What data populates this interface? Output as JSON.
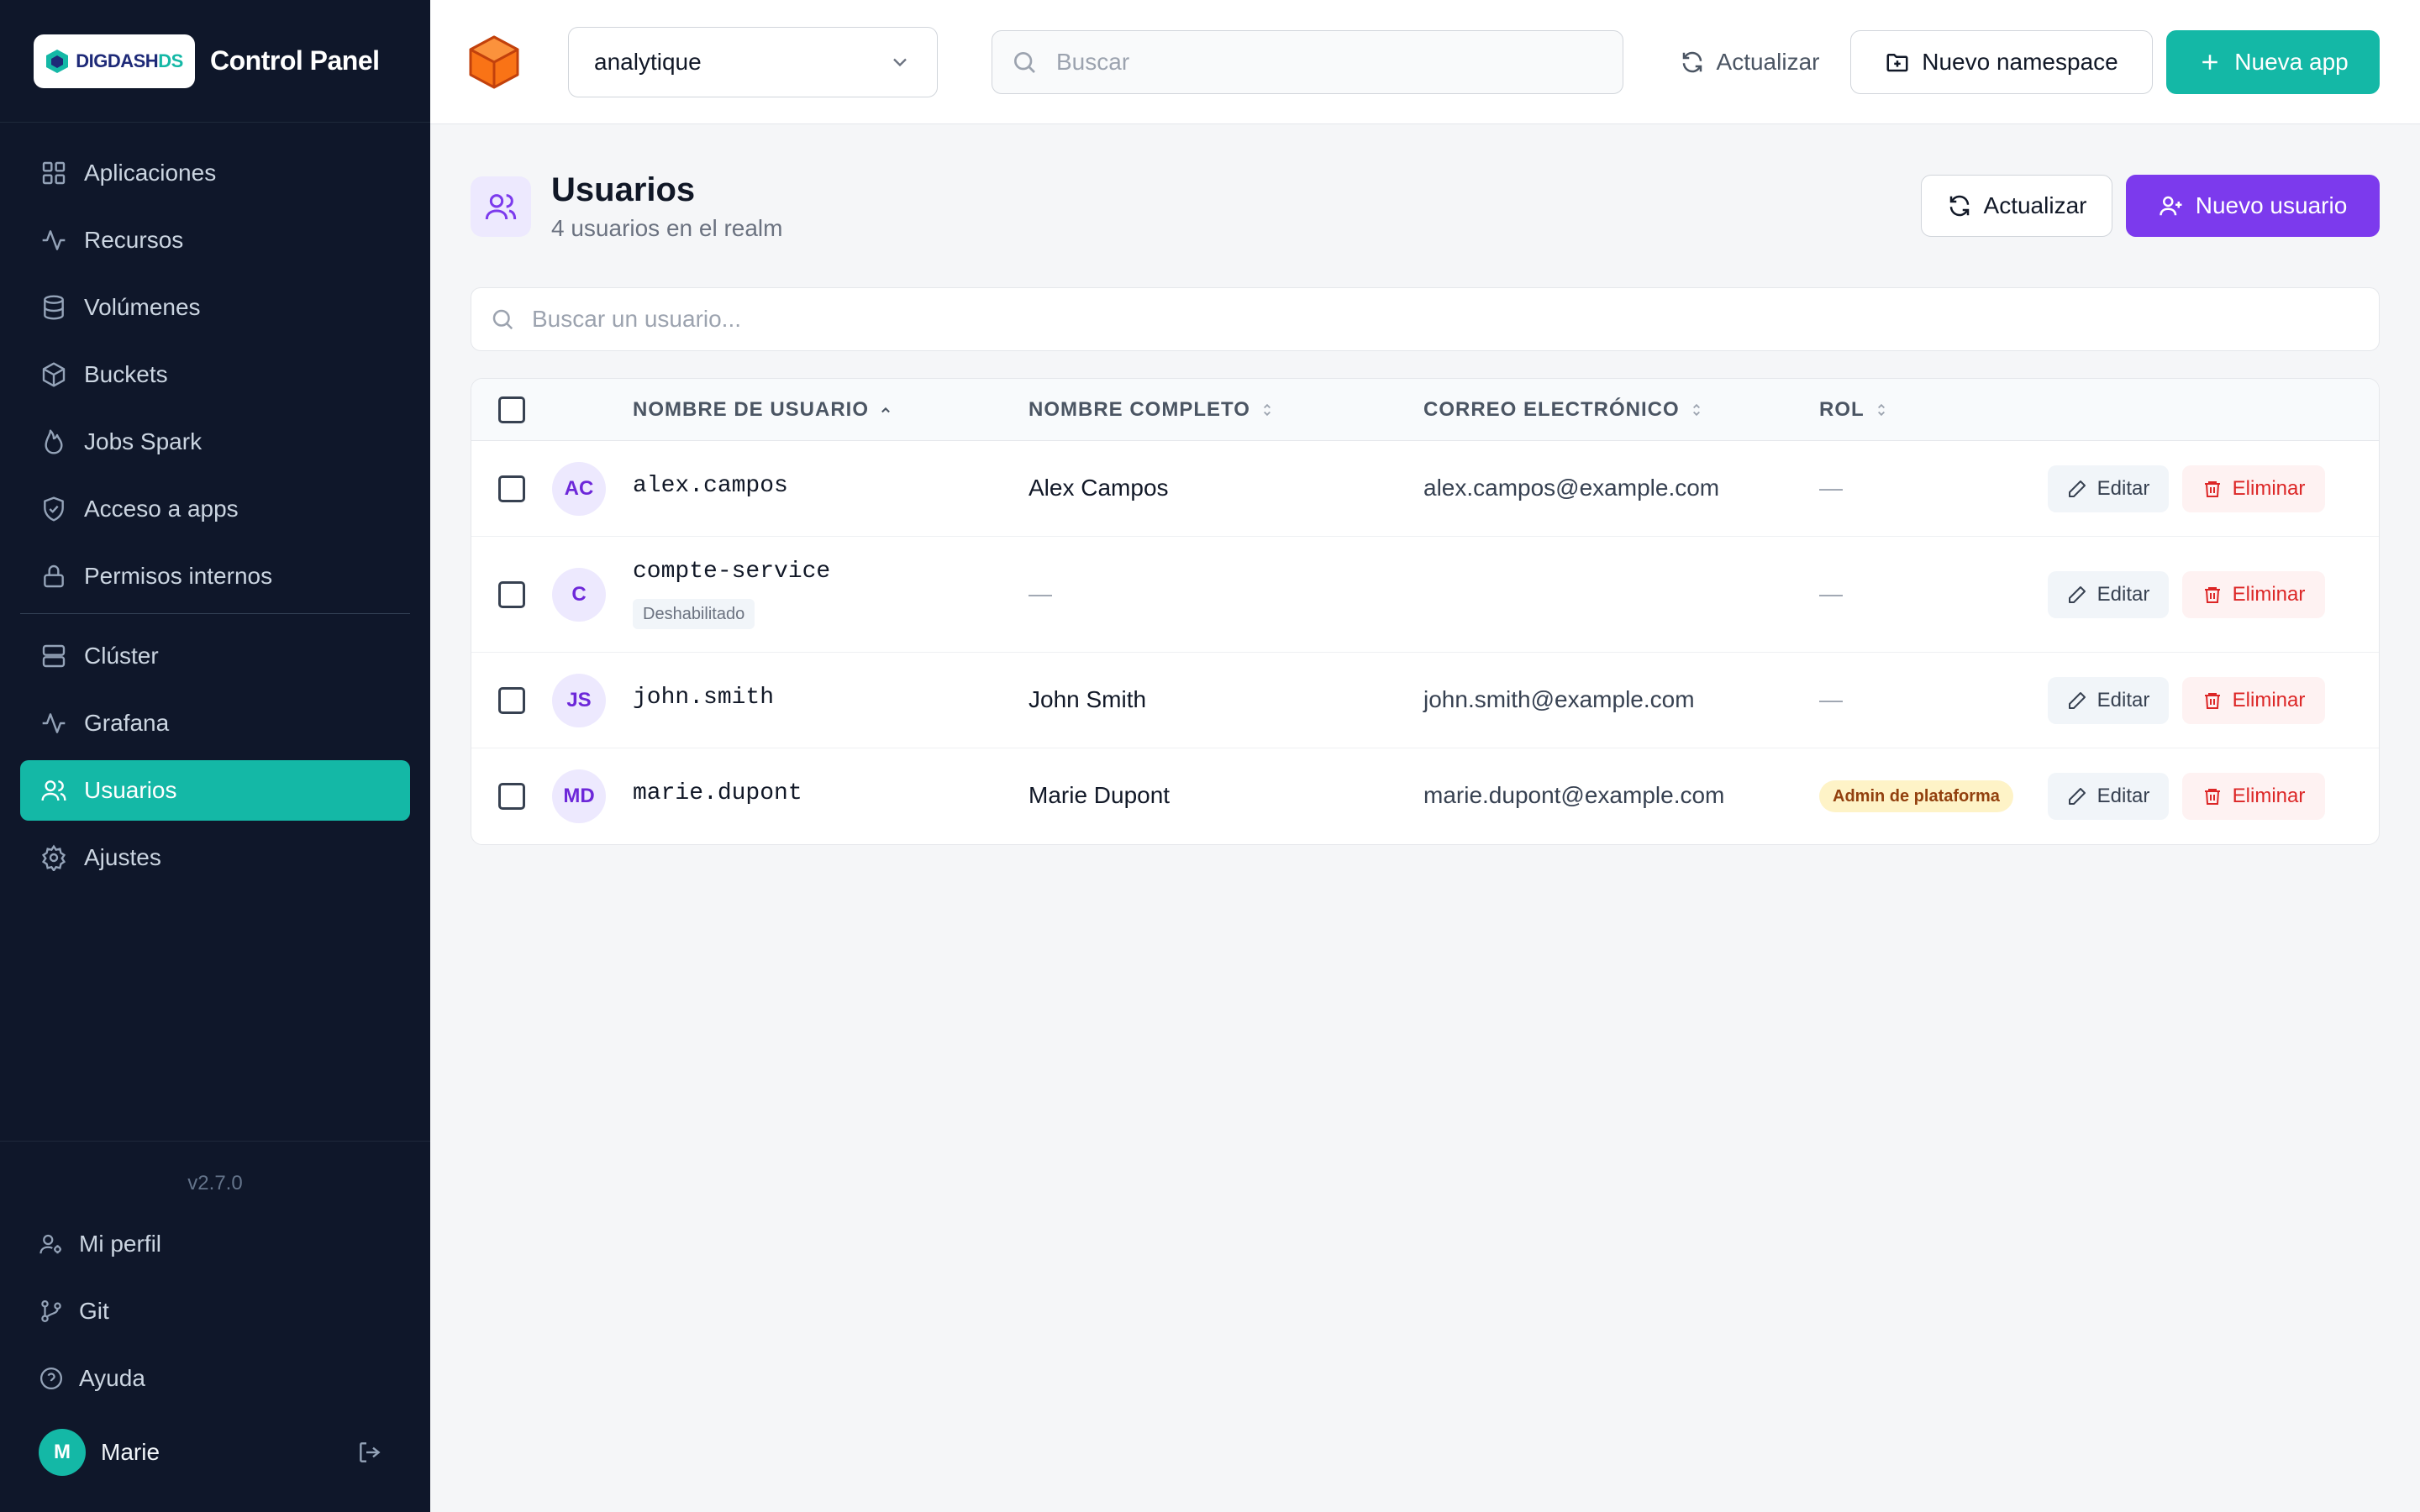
{
  "brand": {
    "logo_main": "DIGDASH",
    "logo_suffix": "DS",
    "title": "Control Panel"
  },
  "sidebar": {
    "items": [
      {
        "label": "Aplicaciones",
        "icon": "grid-icon",
        "active": false
      },
      {
        "label": "Recursos",
        "icon": "activity-icon",
        "active": false
      },
      {
        "label": "Volúmenes",
        "icon": "database-icon",
        "active": false
      },
      {
        "label": "Buckets",
        "icon": "box-icon",
        "active": false
      },
      {
        "label": "Jobs Spark",
        "icon": "flame-icon",
        "active": false
      },
      {
        "label": "Acceso a apps",
        "icon": "shield-icon",
        "active": false
      },
      {
        "label": "Permisos internos",
        "icon": "lock-icon",
        "active": false
      },
      {
        "label": "Clúster",
        "icon": "server-icon",
        "active": false
      },
      {
        "label": "Grafana",
        "icon": "activity-icon",
        "active": false
      },
      {
        "label": "Usuarios",
        "icon": "users-icon",
        "active": true
      },
      {
        "label": "Ajustes",
        "icon": "gear-icon",
        "active": false
      }
    ],
    "version": "v2.7.0",
    "bottom": [
      {
        "label": "Mi perfil",
        "icon": "user-cog-icon"
      },
      {
        "label": "Git",
        "icon": "git-branch-icon"
      },
      {
        "label": "Ayuda",
        "icon": "help-circle-icon"
      }
    ],
    "user": {
      "initial": "M",
      "name": "Marie"
    }
  },
  "topbar": {
    "namespace": "analytique",
    "search_placeholder": "Buscar",
    "refresh_label": "Actualizar",
    "new_namespace_label": "Nuevo namespace",
    "new_app_label": "Nueva app"
  },
  "page": {
    "title": "Usuarios",
    "subtitle": "4 usuarios en el realm",
    "refresh_label": "Actualizar",
    "new_user_label": "Nuevo usuario",
    "search_placeholder": "Buscar un usuario..."
  },
  "table": {
    "columns": {
      "username": "NOMBRE DE USUARIO",
      "fullname": "NOMBRE COMPLETO",
      "email": "CORREO ELECTRÓNICO",
      "role": "ROL"
    },
    "edit_label": "Editar",
    "delete_label": "Eliminar",
    "rows": [
      {
        "initials": "AC",
        "username": "alex.campos",
        "status": "",
        "fullname": "Alex Campos",
        "email": "alex.campos@example.com",
        "role": "—"
      },
      {
        "initials": "C",
        "username": "compte-service",
        "status": "Deshabilitado",
        "fullname": "—",
        "email": "",
        "role": "—"
      },
      {
        "initials": "JS",
        "username": "john.smith",
        "status": "",
        "fullname": "John Smith",
        "email": "john.smith@example.com",
        "role": "—"
      },
      {
        "initials": "MD",
        "username": "marie.dupont",
        "status": "",
        "fullname": "Marie Dupont",
        "email": "marie.dupont@example.com",
        "role": "Admin de plataforma"
      }
    ]
  },
  "colors": {
    "accent": "#14b8a6",
    "primary": "#7c3aed",
    "sidebar_bg": "#0f172a",
    "danger": "#dc2626",
    "role_badge": "#fef3c7"
  }
}
